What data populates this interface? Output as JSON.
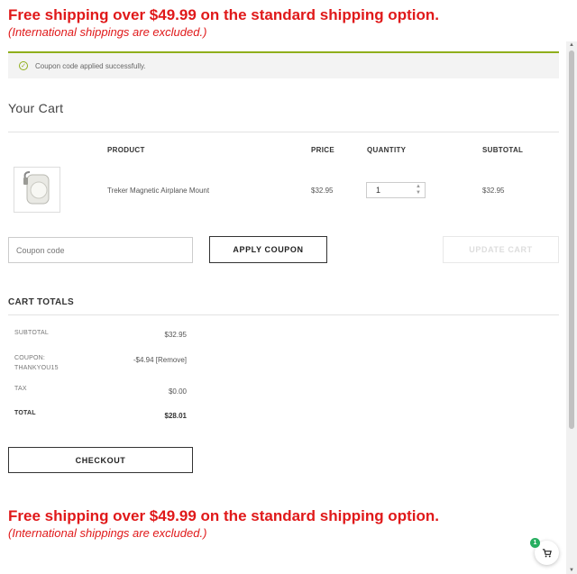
{
  "promo": {
    "title": "Free shipping over $49.99 on the standard shipping option.",
    "subtitle": "(International shippings are excluded.)"
  },
  "notice": {
    "message": "Coupon code applied successfully."
  },
  "cart": {
    "title": "Your Cart",
    "columns": {
      "product": "PRODUCT",
      "price": "PRICE",
      "quantity": "QUANTITY",
      "subtotal": "SUBTOTAL"
    },
    "items": [
      {
        "name": "Treker Magnetic Airplane Mount",
        "price": "$32.95",
        "quantity": "1",
        "subtotal": "$32.95"
      }
    ]
  },
  "coupon": {
    "placeholder": "Coupon code",
    "apply_label": "APPLY COUPON",
    "update_label": "UPDATE CART"
  },
  "totals": {
    "title": "CART TOTALS",
    "subtotal_label": "SUBTOTAL",
    "subtotal_value": "$32.95",
    "coupon_label_line1": "COUPON:",
    "coupon_label_line2": "THANKYOU15",
    "coupon_value": "-$4.94",
    "coupon_remove": "[Remove]",
    "tax_label": "TAX",
    "tax_value": "$0.00",
    "total_label": "TOTAL",
    "total_value": "$28.01"
  },
  "checkout": {
    "label": "CHECKOUT"
  },
  "cart_fab": {
    "count": "1"
  },
  "colors": {
    "promo": "#e0191a",
    "notice_accent": "#8fae1b",
    "badge": "#27ae60"
  }
}
